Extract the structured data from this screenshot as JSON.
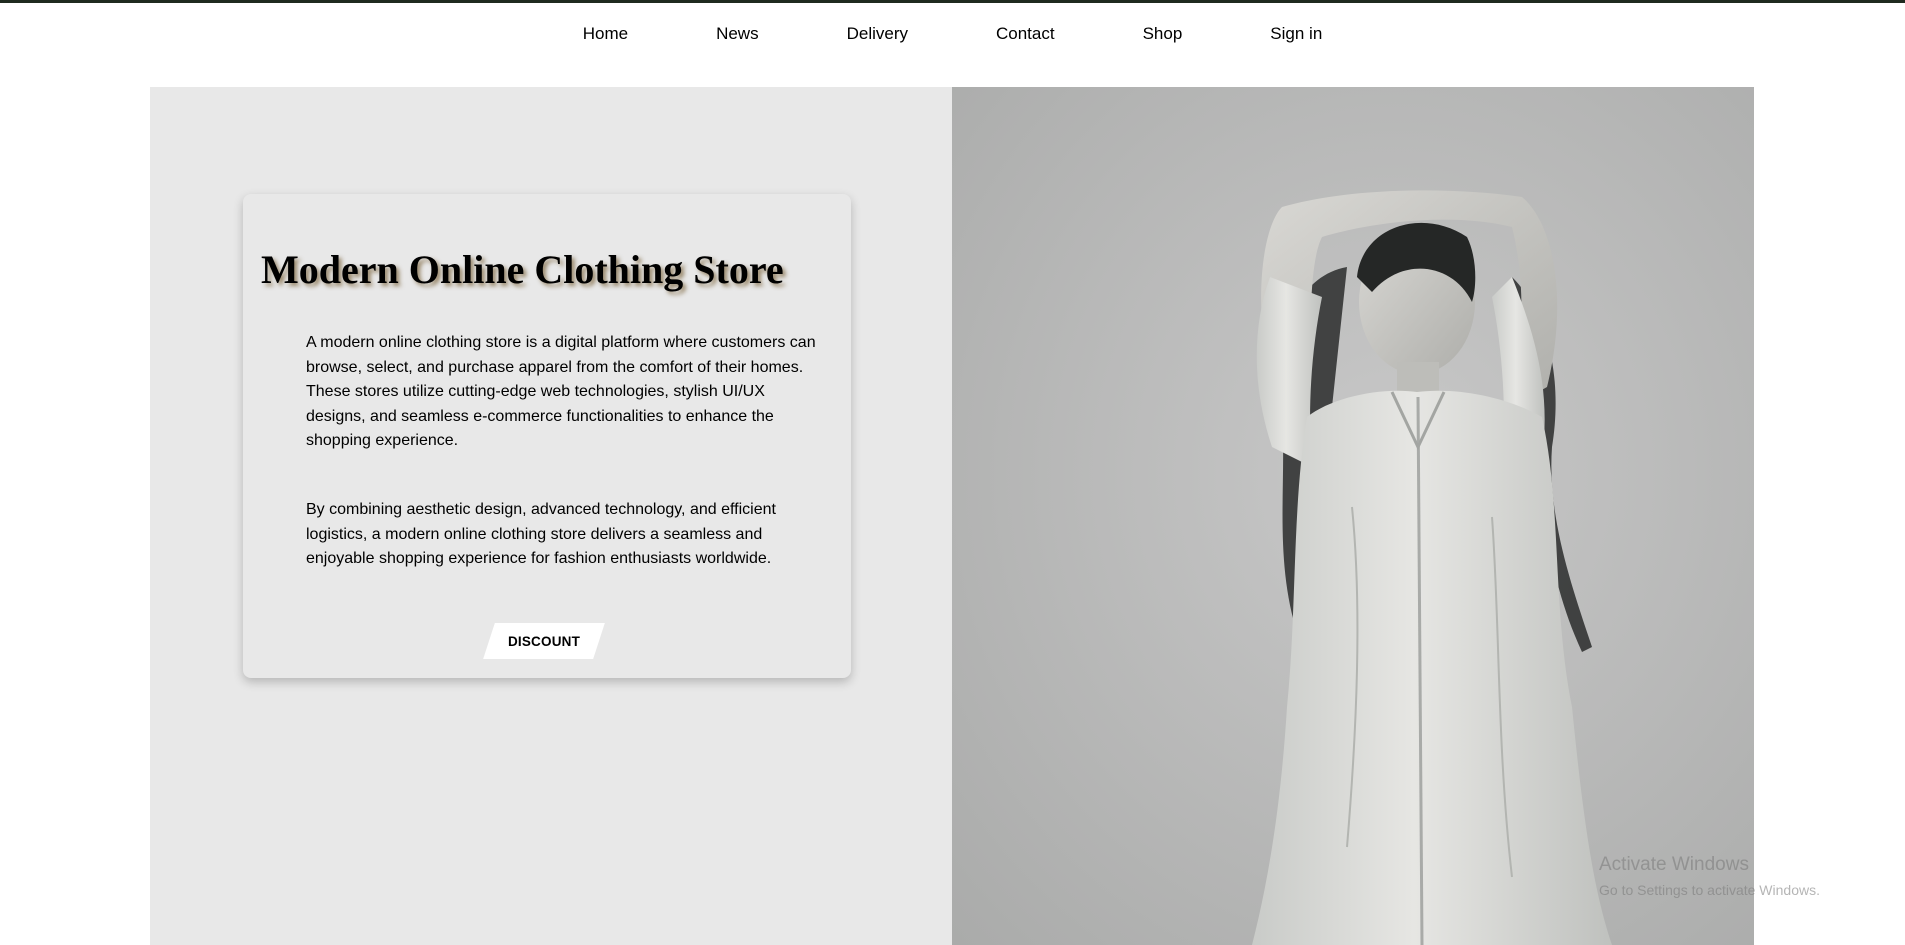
{
  "nav": {
    "items": [
      {
        "label": "Home"
      },
      {
        "label": "News"
      },
      {
        "label": "Delivery"
      },
      {
        "label": "Contact"
      },
      {
        "label": "Shop"
      },
      {
        "label": "Sign in"
      }
    ]
  },
  "hero": {
    "title": "Modern Online Clothing Store",
    "paragraphs": [
      "A modern online clothing store is a digital platform where customers can browse, select, and purchase apparel from the comfort of their homes. These stores utilize cutting-edge web technologies, stylish UI/UX designs, and seamless e-commerce functionalities to enhance the shopping experience.",
      "By combining aesthetic design, advanced technology, and efficient logistics, a modern online clothing store delivers a seamless and enjoyable shopping experience for fashion enthusiasts worldwide."
    ],
    "button_label": "DISCOUNT",
    "image_icon": "fashion-model-photo"
  },
  "overlay": {
    "title": "Activate Windows",
    "subtitle": "Go to Settings to activate Windows."
  },
  "colors": {
    "top_strip": "#1f2a1f",
    "hero_left_bg": "#e8e8e8",
    "photo_bg": "#b9b9b9",
    "button_bg": "#ffffff"
  }
}
